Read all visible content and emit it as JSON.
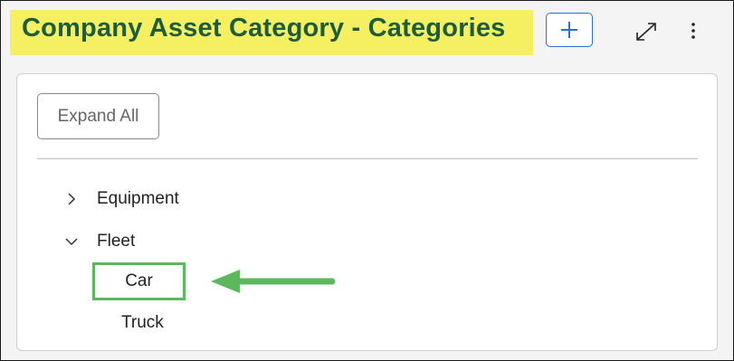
{
  "header": {
    "title": "Company Asset Category - Categories",
    "add_icon": "plus-icon",
    "expand_icon": "expand-diagonal-icon",
    "more_icon": "more-vertical-icon"
  },
  "panel": {
    "expand_all_label": "Expand All",
    "tree": [
      {
        "label": "Equipment",
        "state": "collapsed",
        "icon": "chevron-right-icon"
      },
      {
        "label": "Fleet",
        "state": "expanded",
        "icon": "chevron-down-icon",
        "children": [
          {
            "label": "Car",
            "highlighted": true
          },
          {
            "label": "Truck"
          }
        ]
      }
    ]
  },
  "colors": {
    "title_highlight": "#f5f062",
    "title_text": "#1e5c3e",
    "accent_blue": "#2a6fd1",
    "annotation_green": "#5cb85c"
  }
}
